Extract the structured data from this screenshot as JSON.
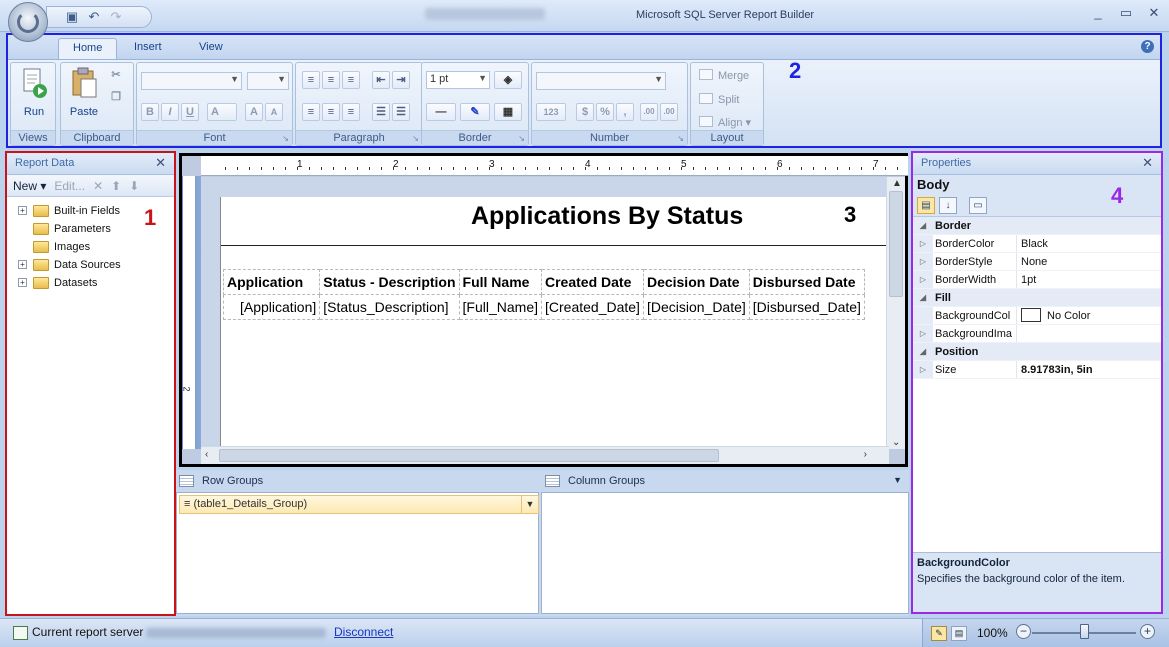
{
  "window": {
    "app_title": "Microsoft SQL Server Report Builder",
    "controls": [
      "_",
      "▭",
      "✕"
    ]
  },
  "ribbon": {
    "tabs": [
      "Home",
      "Insert",
      "View"
    ],
    "groups": {
      "views": {
        "label": "Views",
        "run": "Run"
      },
      "clipboard": {
        "label": "Clipboard",
        "paste": "Paste"
      },
      "font": {
        "label": "Font",
        "bold": "B",
        "italic": "I",
        "underline": "U",
        "font_color": "A",
        "grow": "A",
        "shrink": "A"
      },
      "paragraph": {
        "label": "Paragraph"
      },
      "border": {
        "label": "Border",
        "width": "1 pt"
      },
      "number": {
        "label": "Number",
        "currency": "$",
        "percent": "%",
        "comma": ",",
        "placeholder": "123",
        "increase": ".00",
        "decrease": ".00"
      },
      "layout": {
        "label": "Layout",
        "merge": "Merge",
        "split": "Split",
        "align": "Align"
      }
    }
  },
  "annotations": {
    "one": "1",
    "two": "2",
    "three": "3",
    "four": "4"
  },
  "report_data": {
    "title": "Report Data",
    "toolbar": {
      "new": "New",
      "edit": "Edit..."
    },
    "items": [
      {
        "label": "Built-in Fields",
        "expandable": true
      },
      {
        "label": "Parameters",
        "expandable": false
      },
      {
        "label": "Images",
        "expandable": false
      },
      {
        "label": "Data Sources",
        "expandable": true
      },
      {
        "label": "Datasets",
        "expandable": true
      }
    ]
  },
  "design": {
    "ruler_numbers": [
      "1",
      "2",
      "3",
      "4",
      "5",
      "6",
      "7"
    ],
    "ruler_left_number": "2",
    "report_title": "Applications By Status",
    "table": {
      "headers": [
        "Application",
        "Status - Description",
        "Full Name",
        "Created Date",
        "Decision Date",
        "Disbursed Date"
      ],
      "row": [
        "[Application]",
        "[Status_Description]",
        "[Full_Name]",
        "[Created_Date]",
        "[Decision_Date]",
        "[Disbursed_Date]"
      ]
    }
  },
  "groups": {
    "row_title": "Row Groups",
    "column_title": "Column Groups",
    "row_item": "≡ (table1_Details_Group)"
  },
  "properties": {
    "title": "Properties",
    "object": "Body",
    "rows": [
      {
        "type": "cat",
        "name": "Border"
      },
      {
        "type": "prop",
        "name": "BorderColor",
        "value": "Black"
      },
      {
        "type": "prop",
        "name": "BorderStyle",
        "value": "None"
      },
      {
        "type": "prop",
        "name": "BorderWidth",
        "value": "1pt"
      },
      {
        "type": "cat",
        "name": "Fill"
      },
      {
        "type": "prop",
        "name": "BackgroundCol",
        "value": "No Color"
      },
      {
        "type": "prop",
        "name": "BackgroundIma",
        "value": ""
      },
      {
        "type": "cat",
        "name": "Position"
      },
      {
        "type": "prop",
        "name": "Size",
        "value": "8.91783in, 5in"
      }
    ],
    "description": {
      "title": "BackgroundColor",
      "text": "Specifies the background color of the item."
    }
  },
  "statusbar": {
    "server_label": "Current report server",
    "disconnect": "Disconnect",
    "zoom": "100%"
  },
  "colors": {
    "ribbon_outline": "#1e22e2",
    "report_data_outline": "#c8131a",
    "design_outline": "#000000",
    "properties_outline": "#9a28e5"
  }
}
